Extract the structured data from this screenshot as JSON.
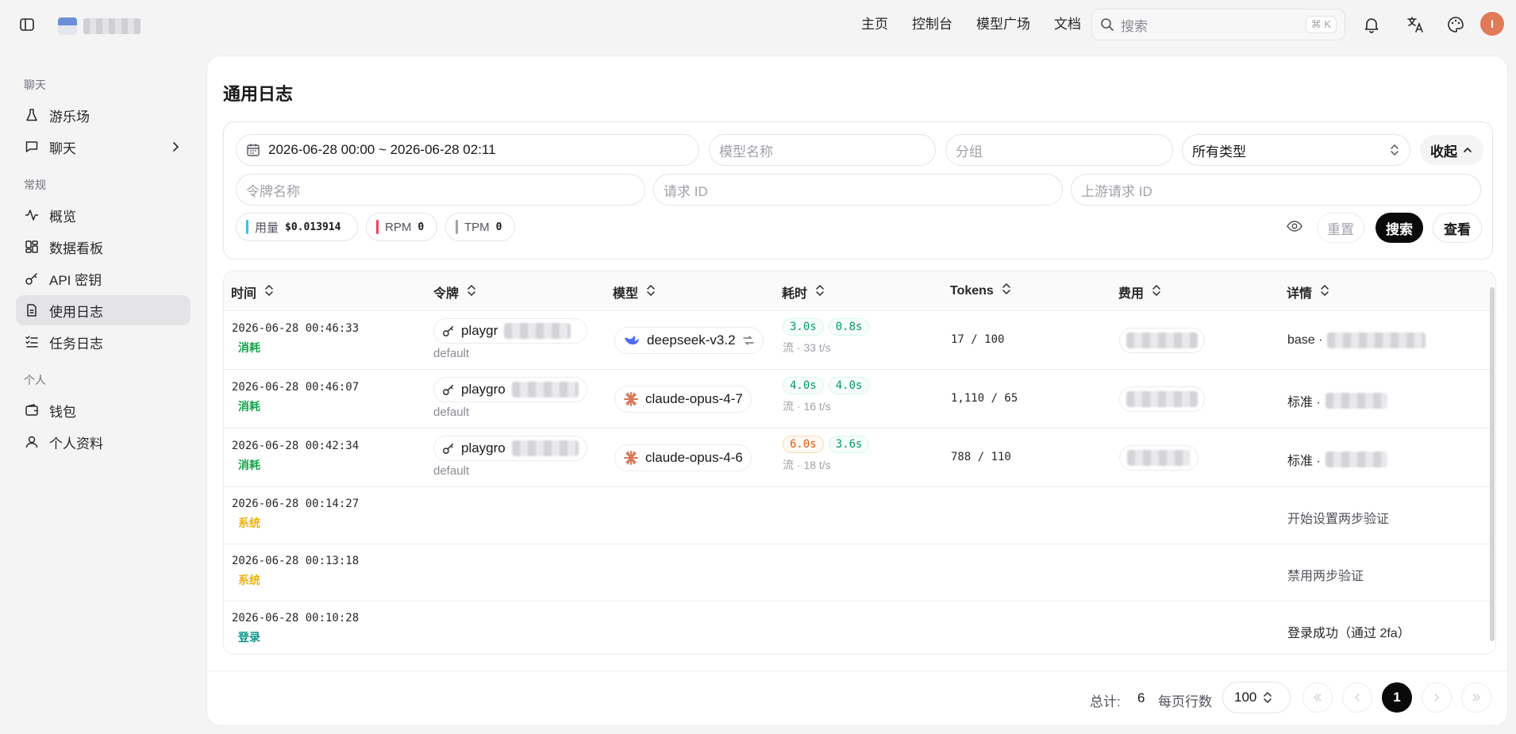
{
  "header": {
    "nav": [
      "主页",
      "控制台",
      "模型广场",
      "文档"
    ],
    "search_placeholder": "搜索",
    "search_shortcut": "⌘ K",
    "avatar_initial": "I"
  },
  "sidebar": {
    "sections": [
      {
        "title": "聊天",
        "items": [
          {
            "label": "游乐场",
            "icon": "flask-icon"
          },
          {
            "label": "聊天",
            "icon": "message-icon"
          }
        ]
      },
      {
        "title": "常规",
        "items": [
          {
            "label": "概览",
            "icon": "activity-icon"
          },
          {
            "label": "数据看板",
            "icon": "dashboard-icon"
          },
          {
            "label": "API 密钥",
            "icon": "key-icon"
          },
          {
            "label": "使用日志",
            "icon": "file-icon",
            "active": true
          },
          {
            "label": "任务日志",
            "icon": "list-check-icon"
          }
        ]
      },
      {
        "title": "个人",
        "items": [
          {
            "label": "钱包",
            "icon": "wallet-icon"
          },
          {
            "label": "个人资料",
            "icon": "user-icon"
          }
        ]
      }
    ]
  },
  "page": {
    "title": "通用日志"
  },
  "filters": {
    "date_range": "2026-06-28 00:00 ~ 2026-06-28 02:11",
    "model_placeholder": "模型名称",
    "group_placeholder": "分组",
    "type_value": "所有类型",
    "collapse_label": "收起",
    "token_placeholder": "令牌名称",
    "request_id_placeholder": "请求 ID",
    "upstream_id_placeholder": "上游请求 ID",
    "reset_label": "重置",
    "search_label": "搜索",
    "view_label": "查看"
  },
  "stats": {
    "usage_label": "用量",
    "usage_value": "$0.013914",
    "rpm_label": "RPM",
    "rpm_value": "0",
    "tpm_label": "TPM",
    "tpm_value": "0",
    "colors": {
      "usage": "#38bdf8",
      "rpm": "#f43f5e",
      "tpm": "#a1a1aa"
    }
  },
  "table": {
    "columns": [
      "时间",
      "令牌",
      "模型",
      "耗时",
      "Tokens",
      "费用",
      "详情"
    ],
    "rows": [
      {
        "time": "2026-06-28 00:46:33",
        "type": "消耗",
        "token": "playgr",
        "group": "default",
        "model": "deepseek-v3.2",
        "t1": "3.0s",
        "t2": "0.8s",
        "speed": "流 · 33 t/s",
        "tokens": "17 / 100",
        "detail": "base ·"
      },
      {
        "time": "2026-06-28 00:46:07",
        "type": "消耗",
        "token": "playgro",
        "group": "default",
        "model": "claude-opus-4-7",
        "t1": "4.0s",
        "t2": "4.0s",
        "speed": "流 · 16 t/s",
        "tokens": "1,110 / 65",
        "detail": "标准 ·"
      },
      {
        "time": "2026-06-28 00:42:34",
        "type": "消耗",
        "token": "playgro",
        "group": "default",
        "model": "claude-opus-4-6",
        "t1": "6.0s",
        "t2": "3.6s",
        "speed": "流 · 18 t/s",
        "tokens": "788 / 110",
        "detail": "标准 ·"
      },
      {
        "time": "2026-06-28 00:14:27",
        "type": "系统",
        "detail": "开始设置两步验证"
      },
      {
        "time": "2026-06-28 00:13:18",
        "type": "系统",
        "detail": "禁用两步验证"
      },
      {
        "time": "2026-06-28 00:10:28",
        "type": "登录",
        "detail": "登录成功（通过 2fa）"
      }
    ]
  },
  "pagination": {
    "total_label": "总计:",
    "total_value": "6",
    "per_page_label": "每页行数",
    "per_page_value": "100",
    "current_page": "1"
  }
}
